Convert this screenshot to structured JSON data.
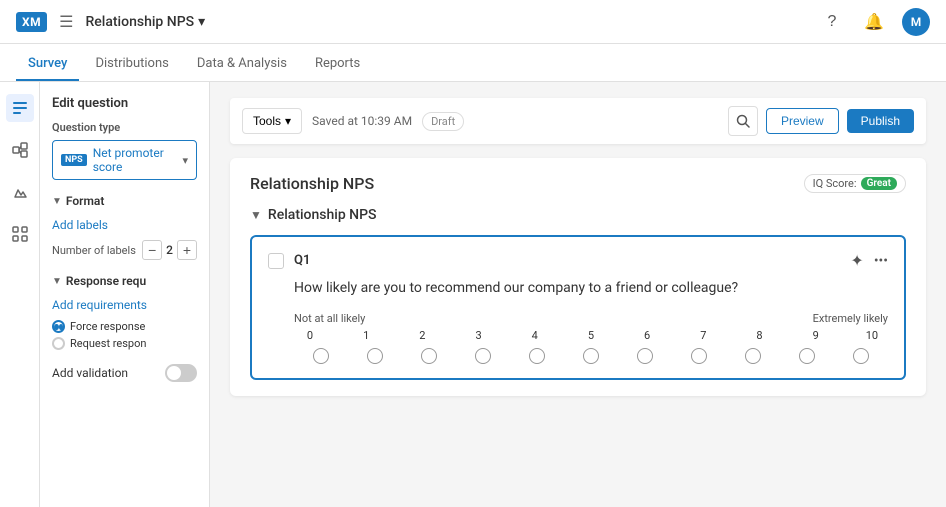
{
  "app": {
    "logo": "XM",
    "title": "Relationship NPS",
    "title_chevron": "▾"
  },
  "nav": {
    "help_icon": "?",
    "bell_icon": "🔔",
    "avatar_label": "M"
  },
  "tabs": [
    {
      "id": "survey",
      "label": "Survey",
      "active": true
    },
    {
      "id": "distributions",
      "label": "Distributions",
      "active": false
    },
    {
      "id": "data-analysis",
      "label": "Data & Analysis",
      "active": false
    },
    {
      "id": "reports",
      "label": "Reports",
      "active": false
    }
  ],
  "icon_sidebar": [
    {
      "id": "questions",
      "icon": "☰",
      "active": true
    },
    {
      "id": "flow",
      "icon": "⬡",
      "active": false
    },
    {
      "id": "theme",
      "icon": "🖌",
      "active": false
    },
    {
      "id": "settings",
      "icon": "▦",
      "active": false
    }
  ],
  "edit_panel": {
    "title": "Edit question",
    "question_type_label": "Question type",
    "nps_badge": "NPS",
    "nps_text": "Net promoter score",
    "format_title": "Format",
    "add_labels": "Add labels",
    "num_labels_label": "Number of labels",
    "num_labels_value": "2",
    "stepper_minus": "−",
    "stepper_plus": "+",
    "response_req_title": "Response requ",
    "add_requirements": "Add requirements",
    "force_response_label": "Force response",
    "request_response_label": "Request respon",
    "validation_label": "Add validation"
  },
  "toolbar": {
    "tools_label": "Tools",
    "tools_chevron": "▾",
    "saved_text": "Saved at 10:39 AM",
    "draft_label": "Draft",
    "search_icon": "🔍",
    "preview_label": "Preview",
    "publish_label": "Publish"
  },
  "survey": {
    "page_title": "Relationship NPS",
    "iq_score_label": "IQ Score:",
    "great_label": "Great",
    "section_name": "Relationship NPS",
    "question": {
      "number": "Q1",
      "text": "How likely are you to recommend our company to a friend or colleague?",
      "label_left": "Not at all likely",
      "label_right": "Extremely likely",
      "scale_numbers": [
        "0",
        "1",
        "2",
        "3",
        "4",
        "5",
        "6",
        "7",
        "8",
        "9",
        "10"
      ]
    }
  }
}
